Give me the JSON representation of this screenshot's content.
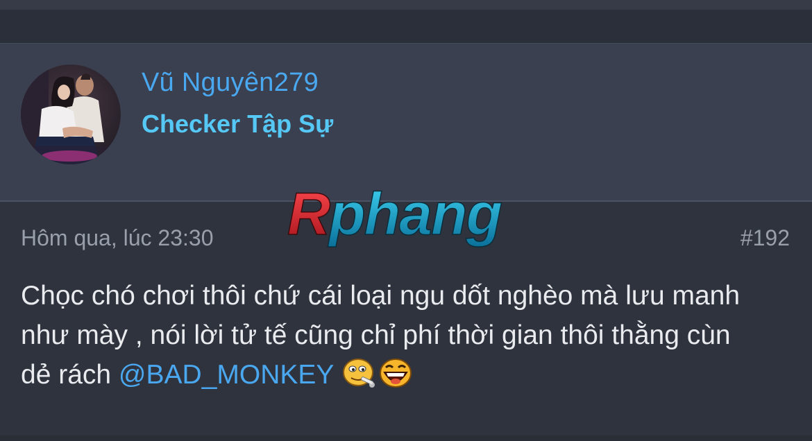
{
  "post": {
    "author": {
      "username": "Vũ Nguyên279",
      "title": "Checker Tập Sự",
      "avatar_icon": "user-avatar-photo"
    },
    "timestamp": "Hôm qua, lúc 23:30",
    "number": "#192",
    "message": {
      "line1": "Chọc chó chơi thôi chứ cái loại ngu dốt nghèo mà lưu manh",
      "line2": "như mày , nói lời tử tế cũng chỉ phí thời gian thôi thằng cùn",
      "line3_prefix": "dẻ rách ",
      "mention": "@BAD_MONKEY",
      "smilies": [
        "smilie-smoking-icon",
        "smilie-laughing-icon"
      ]
    }
  },
  "watermark": {
    "text": "Rphang"
  },
  "colors": {
    "username": "#4aa8f0",
    "usertitle": "#56c8f5",
    "mention": "#4aa8f0",
    "watermark_red": "#d8222a",
    "watermark_blue": "#17a8cc"
  }
}
